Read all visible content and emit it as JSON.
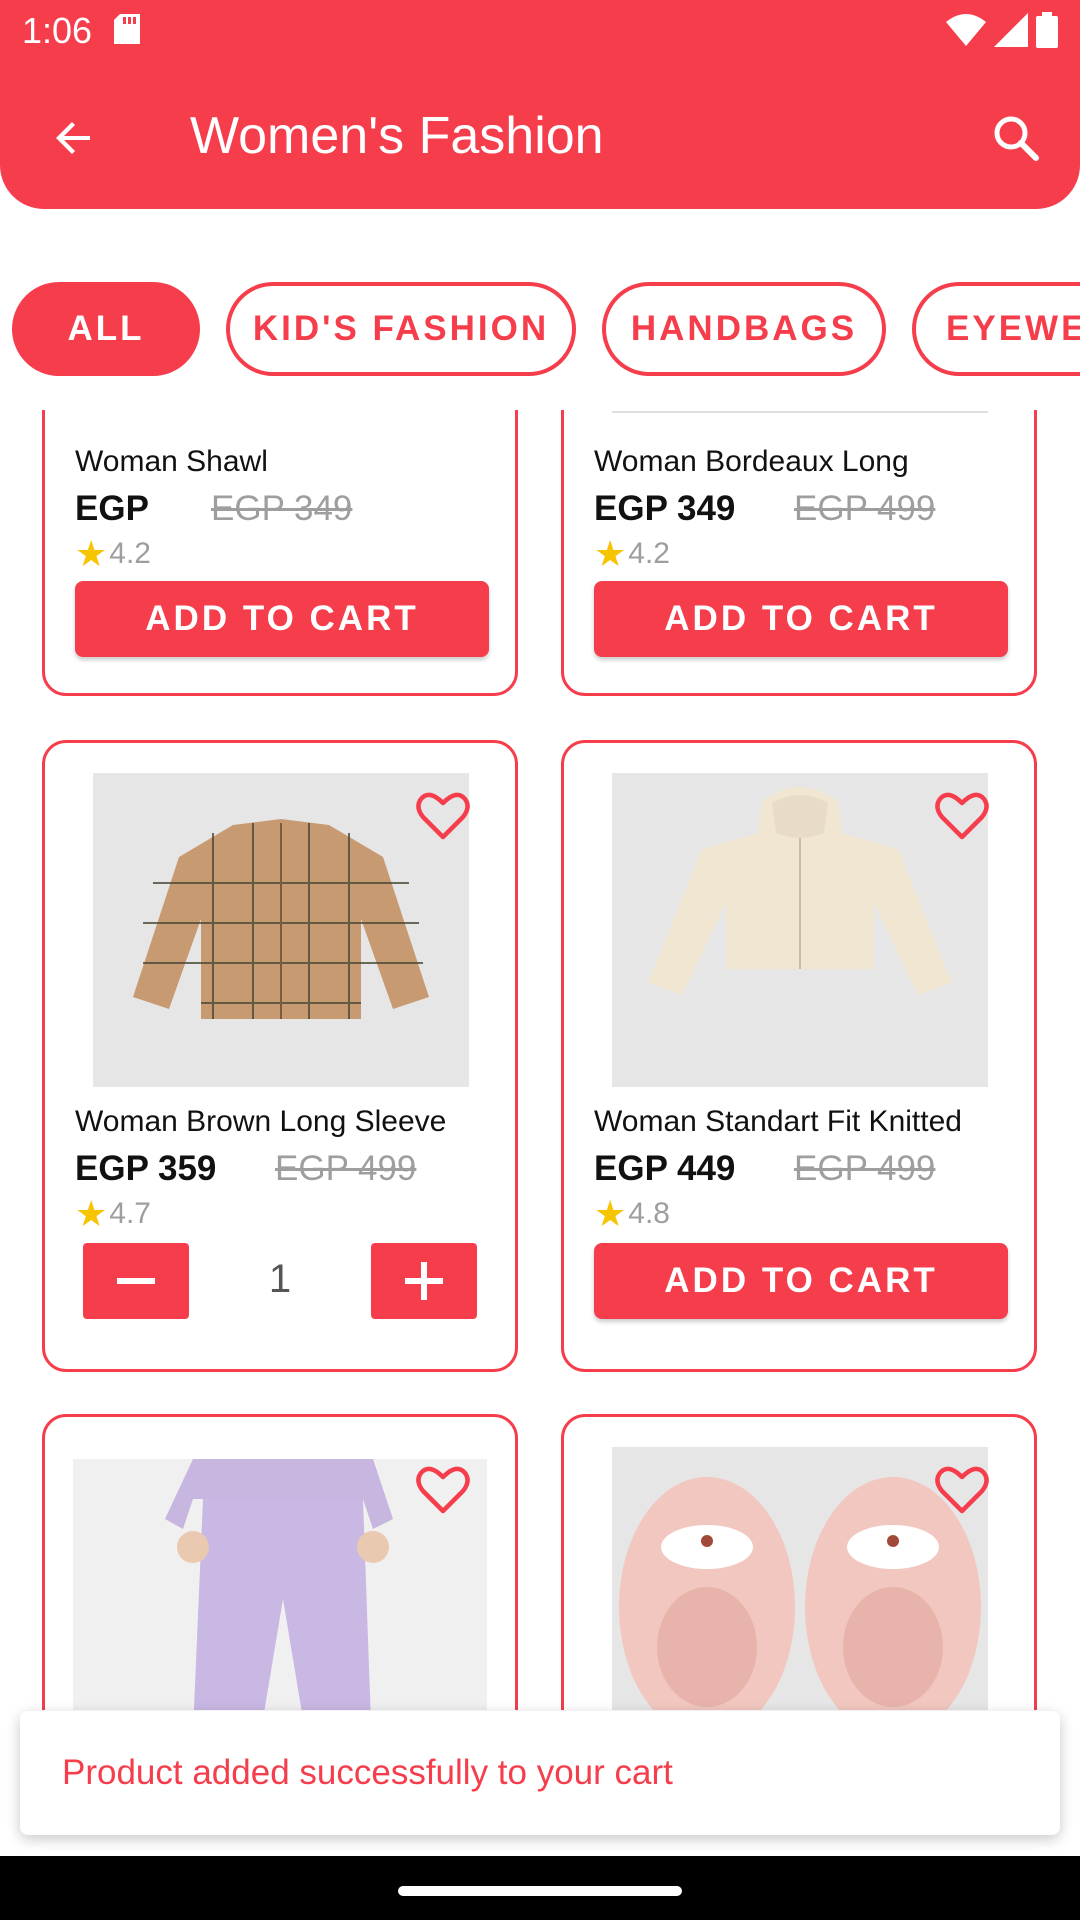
{
  "status": {
    "time": "1:06"
  },
  "header": {
    "title": "Women's Fashion"
  },
  "categories": [
    {
      "label": "ALL",
      "active": true
    },
    {
      "label": "KID'S FASHION",
      "active": false
    },
    {
      "label": "HANDBAGS",
      "active": false
    },
    {
      "label": "EYEWE",
      "active": false
    }
  ],
  "products": [
    {
      "name": "Woman Shawl",
      "price": "EGP",
      "old_price": "EGP 349",
      "rating": "4.2",
      "action": "ADD TO CART"
    },
    {
      "name": "Woman Bordeaux Long",
      "price": "EGP 349",
      "old_price": "EGP 499",
      "rating": "4.2",
      "action": "ADD TO CART"
    },
    {
      "name": "Woman Brown Long Sleeve",
      "price": "EGP 359",
      "old_price": "EGP 499",
      "rating": "4.7",
      "quantity": "1"
    },
    {
      "name": "Woman Standart Fit Knitted",
      "price": "EGP 449",
      "old_price": "EGP 499",
      "rating": "4.8",
      "action": "ADD TO CART"
    }
  ],
  "toast": {
    "message": "Product added successfully to your cart"
  },
  "colors": {
    "accent": "#f53d4b",
    "star": "#f7c400"
  }
}
